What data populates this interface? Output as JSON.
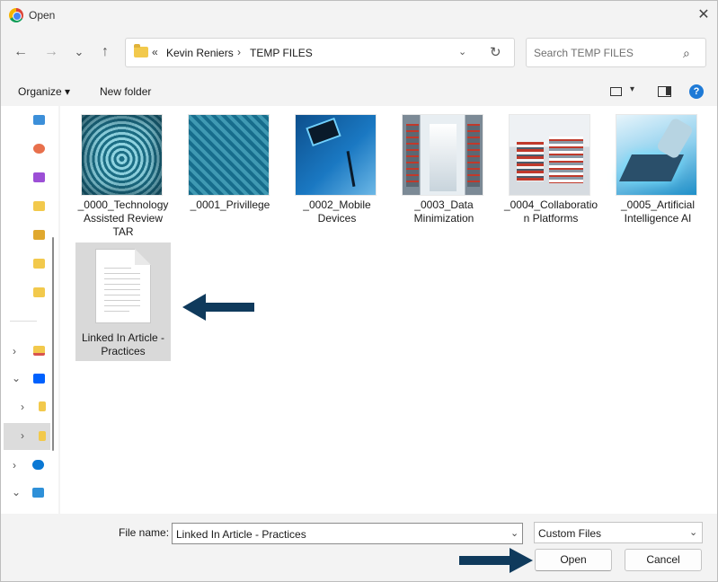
{
  "window": {
    "title": "Open",
    "close_glyph": "✕"
  },
  "nav": {
    "back": "←",
    "forward": "→",
    "recent": "⌄",
    "up": "↑"
  },
  "address": {
    "overflow": "«",
    "crumbs": [
      "Kevin Reniers",
      "TEMP FILES"
    ],
    "separator": "›",
    "dropdown": "⌄",
    "refresh": "↻"
  },
  "search": {
    "placeholder": "Search TEMP FILES",
    "icon": "⌕"
  },
  "toolbar": {
    "organize": "Organize ▾",
    "new_folder": "New folder",
    "view_dropdown": "▾",
    "help": "?"
  },
  "files": [
    {
      "name": "_0000_Technology Assisted Review TAR",
      "kind": "image"
    },
    {
      "name": "_0001_Privillege",
      "kind": "image"
    },
    {
      "name": "_0002_Mobile Devices",
      "kind": "image"
    },
    {
      "name": "_0003_Data Minimization",
      "kind": "image"
    },
    {
      "name": "_0004_Collaboration Platforms",
      "kind": "image"
    },
    {
      "name": "_0005_Artificial Intelligence AI",
      "kind": "image"
    },
    {
      "name": "Linked In Article - Practices",
      "kind": "document",
      "selected": true
    }
  ],
  "bottom": {
    "file_name_label": "File name:",
    "file_name_value": "Linked In Article - Practices",
    "file_type_value": "Custom Files",
    "dropdown": "⌄",
    "open_label": "Open",
    "cancel_label": "Cancel"
  },
  "colors": {
    "arrow": "#0f3a5c",
    "selection": "#d9d9d9",
    "accent": "#1e7ad6"
  }
}
